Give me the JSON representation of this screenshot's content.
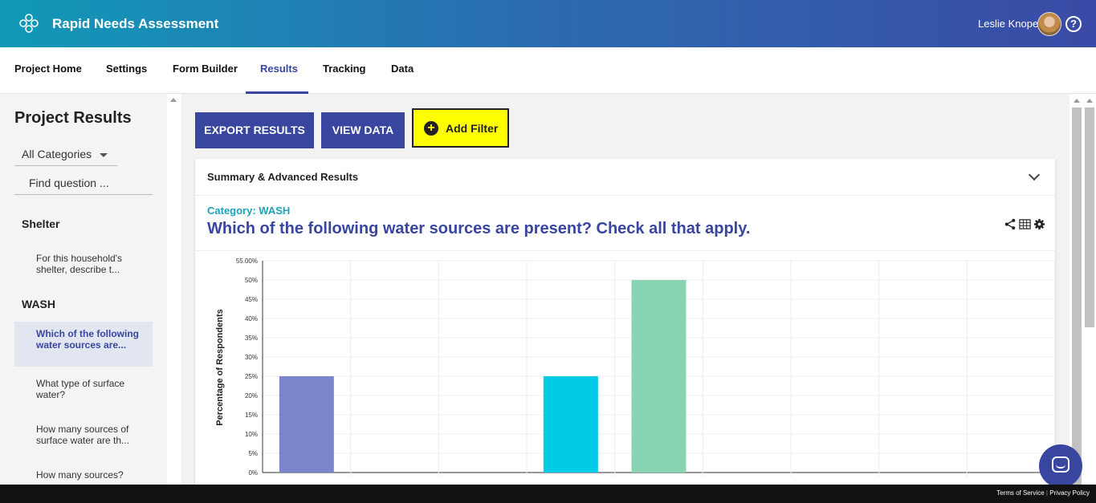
{
  "app": {
    "title": "Rapid Needs Assessment",
    "user_name": "Leslie Knope",
    "help_symbol": "?"
  },
  "nav": {
    "tabs": [
      "Project Home",
      "Settings",
      "Form Builder",
      "Results",
      "Tracking",
      "Data"
    ],
    "active": "Results"
  },
  "sidebar": {
    "title": "Project Results",
    "category_select": "All Categories",
    "search_placeholder": "Find question ...",
    "sections": [
      {
        "name": "Shelter",
        "items": [
          "For this household's shelter, describe t..."
        ]
      },
      {
        "name": "WASH",
        "items": [
          "Which of the following water sources are...",
          "What type of surface water?",
          "How many sources of surface water are th...",
          "How many sources?"
        ]
      }
    ],
    "active_item": "Which of the following water sources are..."
  },
  "toolbar": {
    "export_label": "EXPORT RESULTS",
    "view_data_label": "VIEW DATA",
    "add_filter_label": "Add Filter"
  },
  "card": {
    "header_title": "Summary & Advanced Results",
    "category_label": "Category: WASH",
    "question": "Which of the following water sources are present? Check all that apply."
  },
  "icons": [
    "share-icon",
    "table-icon",
    "gear-icon",
    "chevron-down-icon",
    "help-icon",
    "chat-icon"
  ],
  "colors": {
    "brand": "#3846a0",
    "teal": "#1ba3b8",
    "highlight": "#ffff00"
  },
  "chart_data": {
    "type": "bar",
    "ylabel": "Percentage of Respondents",
    "xlabel": "",
    "ylim": [
      0,
      55
    ],
    "yticks": [
      "0%",
      "5%",
      "10%",
      "15%",
      "20%",
      "25%",
      "30%",
      "35%",
      "40%",
      "45%",
      "50%",
      "55.00%"
    ],
    "ytick_values": [
      0,
      5,
      10,
      15,
      20,
      25,
      30,
      35,
      40,
      45,
      50,
      55
    ],
    "categories": [
      "",
      "",
      "",
      "",
      "",
      "",
      "",
      "",
      ""
    ],
    "values": [
      25,
      0,
      0,
      25,
      50,
      0,
      0,
      0,
      0
    ],
    "bar_colors": [
      "#7986cb",
      "",
      "",
      "#00cce6",
      "#88d4b2",
      "",
      "",
      "",
      ""
    ],
    "grid": true
  },
  "footer": {
    "terms": "Terms of Service",
    "privacy": "Privacy Policy",
    "separator": "|"
  }
}
